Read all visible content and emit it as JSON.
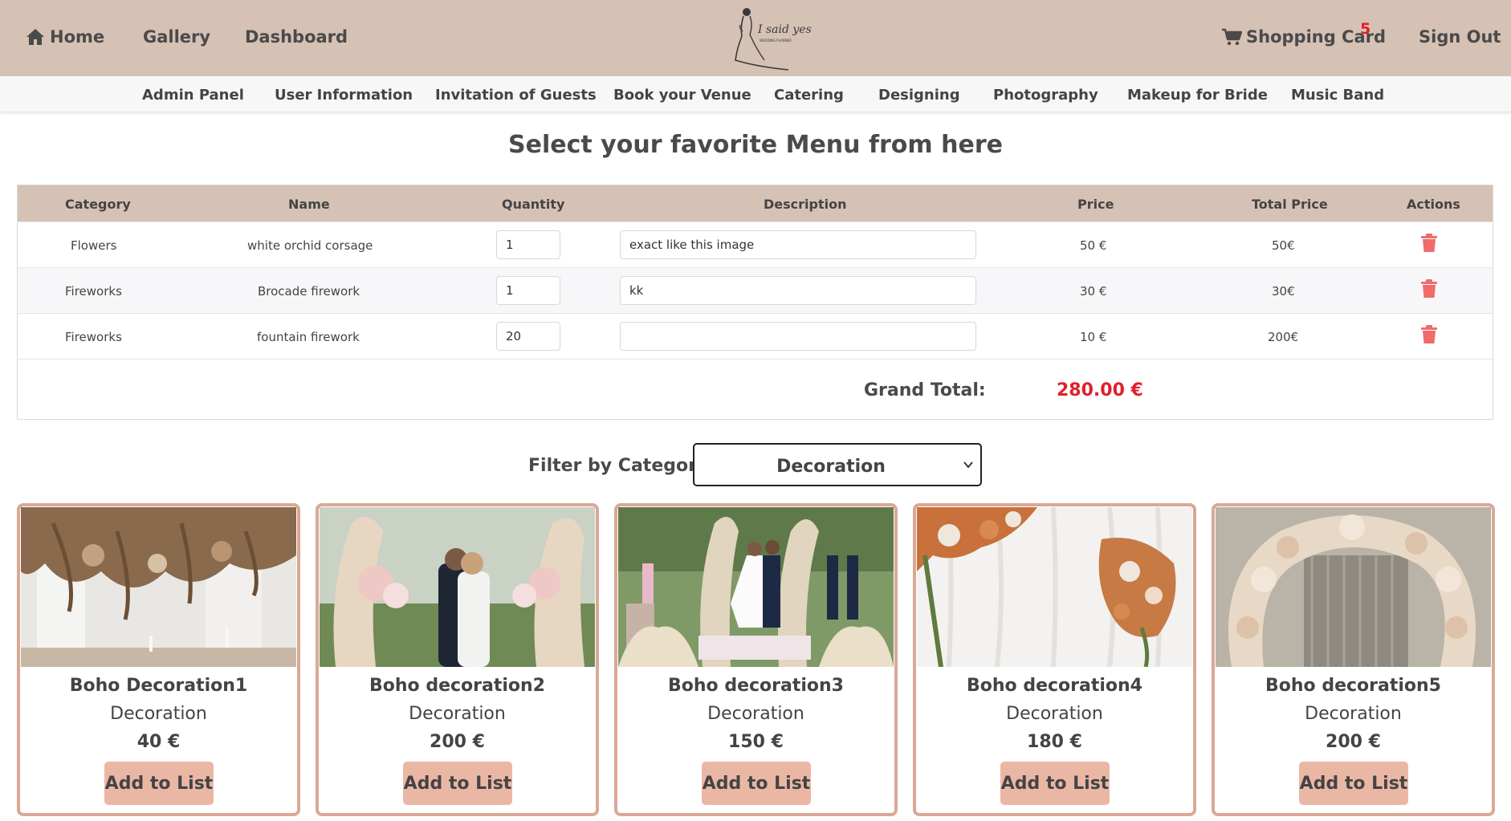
{
  "topnav": {
    "home": "Home",
    "gallery": "Gallery",
    "dashboard": "Dashboard",
    "cart": "Shopping Card",
    "cart_count": "5",
    "signout": "Sign Out"
  },
  "subnav": [
    "Admin Panel",
    "User Information",
    "Invitation of Guests",
    "Book your Venue",
    "Catering",
    "Designing",
    "Photography",
    "Makeup for Bride",
    "Music Band"
  ],
  "page_title": "Select your favorite Menu from here",
  "table": {
    "headers": [
      "Category",
      "Name",
      "Quantity",
      "Description",
      "Price",
      "Total Price",
      "Actions"
    ],
    "rows": [
      {
        "category": "Flowers",
        "name": "white orchid corsage",
        "quantity": "1",
        "description": "exact like this image",
        "price": "50 €",
        "total": "50€"
      },
      {
        "category": "Fireworks",
        "name": "Brocade firework",
        "quantity": "1",
        "description": "kk",
        "price": "30 €",
        "total": "30€"
      },
      {
        "category": "Fireworks",
        "name": "fountain firework",
        "quantity": "20",
        "description": "",
        "price": "10 €",
        "total": "200€"
      }
    ],
    "grand_total_label": "Grand Total:",
    "grand_total_value": "280.00 €"
  },
  "filter": {
    "label": "Filter by Category:",
    "selected": "Decoration"
  },
  "cards": [
    {
      "name": "Boho Decoration1",
      "category": "Decoration",
      "price": "40 €",
      "button": "Add to List"
    },
    {
      "name": "Boho decoration2",
      "category": "Decoration",
      "price": "200 €",
      "button": "Add to List"
    },
    {
      "name": "Boho decoration3",
      "category": "Decoration",
      "price": "150 €",
      "button": "Add to List"
    },
    {
      "name": "Boho decoration4",
      "category": "Decoration",
      "price": "180 €",
      "button": "Add to List"
    },
    {
      "name": "Boho decoration5",
      "category": "Decoration",
      "price": "200 €",
      "button": "Add to List"
    }
  ],
  "colors": {
    "nav_bg": "#d6c1b5",
    "accent_red": "#e0202a",
    "card_border": "#dba896",
    "button_bg": "#ebb7a5",
    "trash": "#f06b6b"
  },
  "icons": [
    "home-icon",
    "shopping-cart-icon",
    "trash-icon",
    "chevron-down-icon",
    "logo-bride-icon"
  ]
}
